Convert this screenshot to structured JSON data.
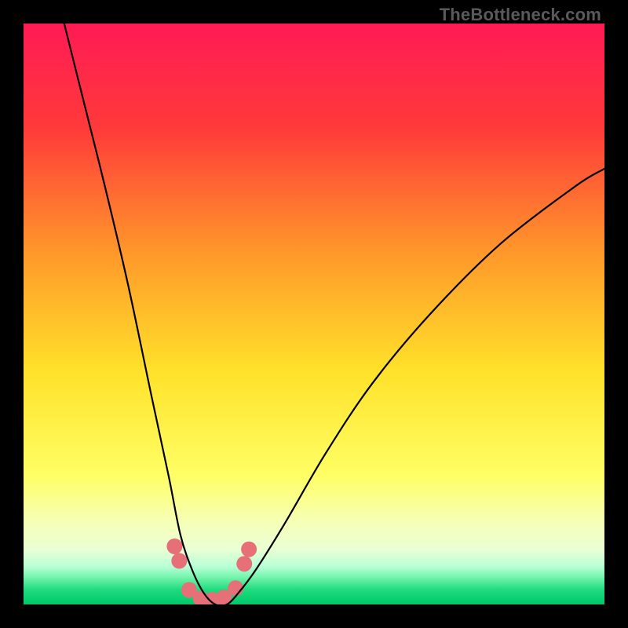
{
  "watermark": "TheBottleneck.com",
  "chart_data": {
    "type": "line",
    "title": "",
    "xlabel": "",
    "ylabel": "",
    "xlim": [
      0,
      100
    ],
    "ylim": [
      0,
      100
    ],
    "gradient_stops": [
      {
        "pos": 0.0,
        "color": "#ff1a55"
      },
      {
        "pos": 0.18,
        "color": "#ff3a3a"
      },
      {
        "pos": 0.4,
        "color": "#ff9a2a"
      },
      {
        "pos": 0.6,
        "color": "#ffe22a"
      },
      {
        "pos": 0.78,
        "color": "#ffff66"
      },
      {
        "pos": 0.86,
        "color": "#f6ffb8"
      },
      {
        "pos": 0.905,
        "color": "#e9ffd4"
      },
      {
        "pos": 0.935,
        "color": "#b8ffd6"
      },
      {
        "pos": 0.955,
        "color": "#6df2a8"
      },
      {
        "pos": 0.975,
        "color": "#1edb7e"
      },
      {
        "pos": 1.0,
        "color": "#00c86a"
      }
    ],
    "series": [
      {
        "name": "bottleneck-curve",
        "x": [
          7,
          10,
          14,
          18,
          22,
          25,
          27,
          29,
          31,
          33,
          35,
          37,
          40,
          45,
          52,
          60,
          70,
          82,
          95,
          100
        ],
        "y": [
          100,
          88,
          72,
          55,
          36,
          22,
          12,
          6,
          2,
          0,
          0,
          2,
          6,
          14,
          26,
          38,
          50,
          62,
          72,
          75
        ]
      }
    ],
    "markers": {
      "name": "highlight-dots",
      "color": "#e76f78",
      "radius": 10,
      "points": [
        {
          "x": 26.0,
          "y": 10.0
        },
        {
          "x": 26.8,
          "y": 7.5
        },
        {
          "x": 28.5,
          "y": 2.5
        },
        {
          "x": 30.5,
          "y": 1.0
        },
        {
          "x": 32.5,
          "y": 0.8
        },
        {
          "x": 34.5,
          "y": 1.2
        },
        {
          "x": 36.5,
          "y": 2.8
        },
        {
          "x": 38.0,
          "y": 7.0
        },
        {
          "x": 38.8,
          "y": 9.5
        }
      ]
    }
  }
}
